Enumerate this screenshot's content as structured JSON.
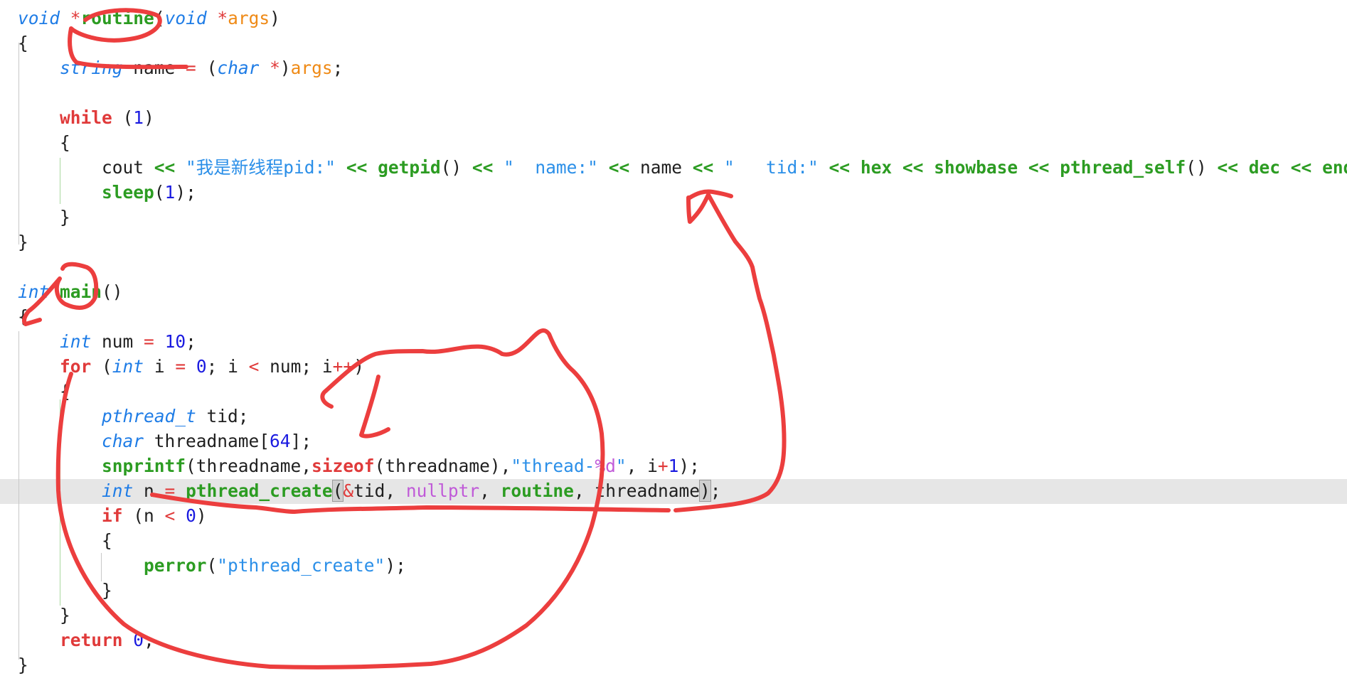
{
  "editor": {
    "lines": [
      {
        "t": [
          [
            "void",
            "kw-type"
          ],
          [
            " ",
            "punc"
          ],
          [
            "*",
            "op"
          ],
          [
            "routine",
            "fn"
          ],
          [
            "(",
            "punc"
          ],
          [
            "void",
            "kw-type"
          ],
          [
            " ",
            "punc"
          ],
          [
            "*",
            "op"
          ],
          [
            "args",
            "param"
          ],
          [
            ")",
            "punc"
          ]
        ]
      },
      {
        "t": [
          [
            "{",
            "punc"
          ]
        ]
      },
      {
        "t": [
          [
            "    ",
            "punc"
          ],
          [
            "string",
            "kw-type"
          ],
          [
            " name ",
            "punc"
          ],
          [
            "=",
            "op"
          ],
          [
            " (",
            "punc"
          ],
          [
            "char",
            "kw-type"
          ],
          [
            " ",
            "punc"
          ],
          [
            "*",
            "op"
          ],
          [
            ")",
            "punc"
          ],
          [
            "args",
            "param"
          ],
          [
            ";",
            "punc"
          ]
        ]
      },
      {
        "t": []
      },
      {
        "t": [
          [
            "    ",
            "punc"
          ],
          [
            "while",
            "kw-ctrl"
          ],
          [
            " (",
            "punc"
          ],
          [
            "1",
            "num"
          ],
          [
            ")",
            "punc"
          ]
        ]
      },
      {
        "t": [
          [
            "    {",
            "punc"
          ]
        ]
      },
      {
        "t": [
          [
            "        cout ",
            "punc"
          ],
          [
            "<<",
            "fn"
          ],
          [
            " ",
            "punc"
          ],
          [
            "\"我是新线程pid:\"",
            "str"
          ],
          [
            " ",
            "punc"
          ],
          [
            "<<",
            "fn"
          ],
          [
            " ",
            "punc"
          ],
          [
            "getpid",
            "fn"
          ],
          [
            "() ",
            "punc"
          ],
          [
            "<<",
            "fn"
          ],
          [
            " ",
            "punc"
          ],
          [
            "\"  name:\"",
            "str"
          ],
          [
            " ",
            "punc"
          ],
          [
            "<<",
            "fn"
          ],
          [
            " name ",
            "punc"
          ],
          [
            "<<",
            "fn"
          ],
          [
            " ",
            "punc"
          ],
          [
            "\"   tid:\"",
            "str"
          ],
          [
            " ",
            "punc"
          ],
          [
            "<<",
            "fn"
          ],
          [
            " ",
            "punc"
          ],
          [
            "hex",
            "fn"
          ],
          [
            " ",
            "punc"
          ],
          [
            "<<",
            "fn"
          ],
          [
            " ",
            "punc"
          ],
          [
            "showbase",
            "fn"
          ],
          [
            " ",
            "punc"
          ],
          [
            "<<",
            "fn"
          ],
          [
            " ",
            "punc"
          ],
          [
            "pthread_self",
            "fn"
          ],
          [
            "() ",
            "punc"
          ],
          [
            "<<",
            "fn"
          ],
          [
            " ",
            "punc"
          ],
          [
            "dec",
            "fn"
          ],
          [
            " ",
            "punc"
          ],
          [
            "<<",
            "fn"
          ],
          [
            " ",
            "punc"
          ],
          [
            "endl",
            "fn"
          ],
          [
            ";",
            "punc"
          ]
        ]
      },
      {
        "t": [
          [
            "        ",
            "punc"
          ],
          [
            "sleep",
            "fn"
          ],
          [
            "(",
            "punc"
          ],
          [
            "1",
            "num"
          ],
          [
            ");",
            "punc"
          ]
        ]
      },
      {
        "t": [
          [
            "    }",
            "punc"
          ]
        ]
      },
      {
        "t": [
          [
            "}",
            "punc"
          ]
        ]
      },
      {
        "t": []
      },
      {
        "t": [
          [
            "int",
            "kw-type"
          ],
          [
            " ",
            "punc"
          ],
          [
            "main",
            "fn"
          ],
          [
            "()",
            "punc"
          ]
        ]
      },
      {
        "t": [
          [
            "{",
            "punc"
          ]
        ]
      },
      {
        "t": [
          [
            "    ",
            "punc"
          ],
          [
            "int",
            "kw-type"
          ],
          [
            " num ",
            "punc"
          ],
          [
            "=",
            "op"
          ],
          [
            " ",
            "punc"
          ],
          [
            "10",
            "num"
          ],
          [
            ";",
            "punc"
          ]
        ]
      },
      {
        "t": [
          [
            "    ",
            "punc"
          ],
          [
            "for",
            "kw-ctrl"
          ],
          [
            " (",
            "punc"
          ],
          [
            "int",
            "kw-type"
          ],
          [
            " i ",
            "punc"
          ],
          [
            "=",
            "op"
          ],
          [
            " ",
            "punc"
          ],
          [
            "0",
            "num"
          ],
          [
            "; i ",
            "punc"
          ],
          [
            "<",
            "op"
          ],
          [
            " num; i",
            "punc"
          ],
          [
            "++",
            "op"
          ],
          [
            ")",
            "punc"
          ]
        ]
      },
      {
        "t": [
          [
            "    {",
            "punc"
          ]
        ]
      },
      {
        "t": [
          [
            "        ",
            "punc"
          ],
          [
            "pthread_t",
            "kw-type"
          ],
          [
            " tid;",
            "punc"
          ]
        ]
      },
      {
        "t": [
          [
            "        ",
            "punc"
          ],
          [
            "char",
            "kw-type"
          ],
          [
            " threadname[",
            "punc"
          ],
          [
            "64",
            "num"
          ],
          [
            "];",
            "punc"
          ]
        ]
      },
      {
        "t": [
          [
            "        ",
            "punc"
          ],
          [
            "snprintf",
            "fn"
          ],
          [
            "(threadname,",
            "punc"
          ],
          [
            "sizeof",
            "kw-ctrl"
          ],
          [
            "(threadname),",
            "punc"
          ],
          [
            "\"thread-",
            "str"
          ],
          [
            "%d",
            "fmt"
          ],
          [
            "\"",
            "str"
          ],
          [
            ", i",
            "punc"
          ],
          [
            "+",
            "op"
          ],
          [
            "1",
            "num"
          ],
          [
            ");",
            "punc"
          ]
        ]
      },
      {
        "t": [
          [
            "        ",
            "punc"
          ],
          [
            "int",
            "kw-type"
          ],
          [
            " n ",
            "punc"
          ],
          [
            "=",
            "op"
          ],
          [
            " ",
            "punc"
          ],
          [
            "pthread_create",
            "fn"
          ],
          [
            "(",
            "bracket"
          ],
          [
            "&",
            "op"
          ],
          [
            "tid, ",
            "punc"
          ],
          [
            "nullptr",
            "nullp"
          ],
          [
            ", ",
            "punc"
          ],
          [
            "routine",
            "fn"
          ],
          [
            ", threadname",
            "punc"
          ],
          [
            ")",
            "bracket"
          ],
          [
            ";",
            "punc"
          ]
        ]
      },
      {
        "t": [
          [
            "        ",
            "punc"
          ],
          [
            "if",
            "kw-ctrl"
          ],
          [
            " (n ",
            "punc"
          ],
          [
            "<",
            "op"
          ],
          [
            " ",
            "punc"
          ],
          [
            "0",
            "num"
          ],
          [
            ")",
            "punc"
          ]
        ]
      },
      {
        "t": [
          [
            "        {",
            "punc"
          ]
        ]
      },
      {
        "t": [
          [
            "            ",
            "punc"
          ],
          [
            "perror",
            "fn"
          ],
          [
            "(",
            "punc"
          ],
          [
            "\"pthread_create\"",
            "str"
          ],
          [
            ");",
            "punc"
          ]
        ]
      },
      {
        "t": [
          [
            "        }",
            "punc"
          ]
        ]
      },
      {
        "t": [
          [
            "    }",
            "punc"
          ]
        ]
      },
      {
        "t": [
          [
            "    ",
            "punc"
          ],
          [
            "return",
            "kw-ctrl"
          ],
          [
            " ",
            "punc"
          ],
          [
            "0",
            "num"
          ],
          [
            ";",
            "punc"
          ]
        ]
      },
      {
        "t": [
          [
            "}",
            "punc"
          ]
        ]
      }
    ]
  },
  "colors": {
    "annotation": "#ec3e3e",
    "current_line": "#e6e6e6"
  }
}
